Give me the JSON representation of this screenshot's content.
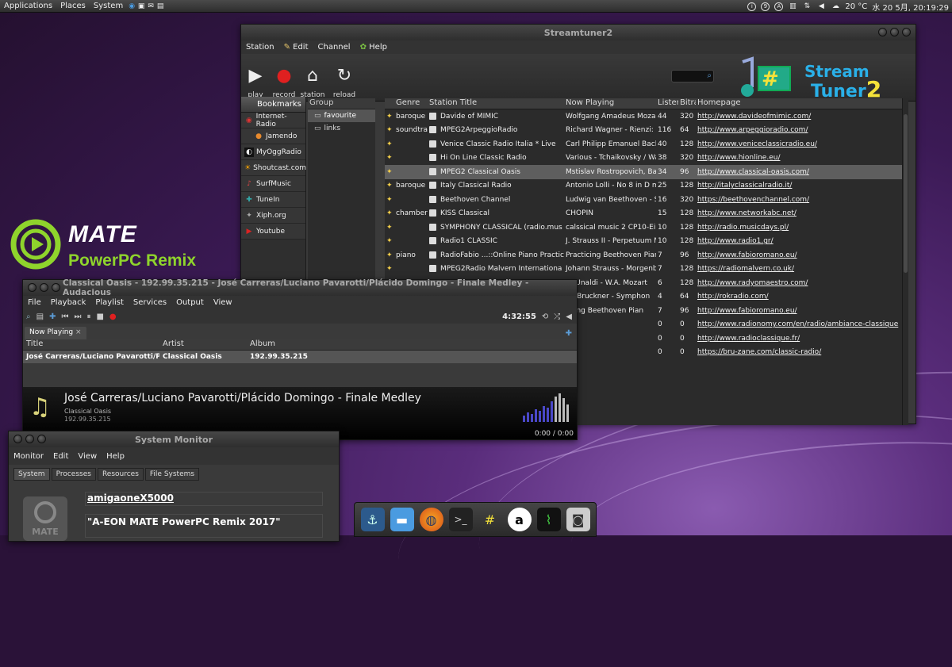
{
  "topbar": {
    "menus": [
      "Applications",
      "Places",
      "System"
    ],
    "circles": [
      "i",
      "9",
      "A"
    ],
    "weather": "20 °C",
    "datetime": "水 20 5月, 20:19:29"
  },
  "logo": {
    "title": "MATE",
    "subtitle": "PowerPC Remix"
  },
  "streamtuner": {
    "title": "Streamtuner2",
    "menu": [
      "Station",
      "Edit",
      "Channel",
      "Help"
    ],
    "tools": [
      {
        "icon": "play-icon",
        "label": "play"
      },
      {
        "icon": "record-icon",
        "label": "record"
      },
      {
        "icon": "home-icon",
        "label": "station"
      },
      {
        "icon": "reload-icon",
        "label": "reload"
      }
    ],
    "brand": {
      "line1": "Stream",
      "line2": "Tuner",
      "num": "2"
    },
    "bookmarks_label": "Bookmarks",
    "channels": [
      {
        "label": "Internet-Radio",
        "color": "#d33"
      },
      {
        "label": "Jamendo",
        "color": "#e88a2d"
      },
      {
        "label": "MyOggRadio",
        "color": "#333"
      },
      {
        "label": "Shoutcast.com",
        "color": "#f3a000"
      },
      {
        "label": "SurfMusic",
        "color": "#d44"
      },
      {
        "label": "TuneIn",
        "color": "#3aa"
      },
      {
        "label": "Xiph.org",
        "color": "#aaa"
      },
      {
        "label": "Youtube",
        "color": "#d22"
      }
    ],
    "group_header": "Group",
    "groups": [
      {
        "label": "favourite",
        "selected": true
      },
      {
        "label": "links",
        "selected": false
      }
    ],
    "headers": [
      "Genre",
      "Station Title",
      "Now Playing",
      "Listen",
      "Bitra",
      "Homepage"
    ],
    "rows": [
      {
        "genre": "baroque",
        "title": "Davide of MIMIC",
        "playing": "Wolfgang Amadeus Mozart",
        "listen": "44",
        "bitrate": "320",
        "home": "http://www.davideofmimic.com/"
      },
      {
        "genre": "soundtra",
        "title": "MPEG2ArpeggioRadio",
        "playing": "Richard Wagner - Rienzi: O",
        "listen": "116",
        "bitrate": "64",
        "home": "http://www.arpeggioradio.com/"
      },
      {
        "genre": "",
        "title": "Venice Classic Radio Italia * Live",
        "playing": "Carl Philipp Emanuel Bach",
        "listen": "40",
        "bitrate": "128",
        "home": "http://www.veniceclassicradio.eu/"
      },
      {
        "genre": "",
        "title": "Hi On Line Classic Radio",
        "playing": "Various - Tchaikovsky / Wa",
        "listen": "38",
        "bitrate": "320",
        "home": "http://www.hionline.eu/"
      },
      {
        "genre": "",
        "title": "MPEG2 Classical Oasis",
        "playing": "Mstislav Rostropovich, Bar",
        "listen": "34",
        "bitrate": "96",
        "home": "http://www.classical-oasis.com/",
        "selected": true
      },
      {
        "genre": "baroque",
        "title": "Italy Classical Radio",
        "playing": "Antonio Lolli - No 8 in D ma",
        "listen": "25",
        "bitrate": "128",
        "home": "http://italyclassicalradio.it/"
      },
      {
        "genre": "",
        "title": "Beethoven Channel",
        "playing": "Ludwig van Beethoven - St",
        "listen": "16",
        "bitrate": "320",
        "home": "https://beethovenchannel.com/"
      },
      {
        "genre": "chamber",
        "title": "KISS Classical",
        "playing": "CHOPIN",
        "listen": "15",
        "bitrate": "128",
        "home": "http://www.networkabc.net/"
      },
      {
        "genre": "",
        "title": "SYMPHONY CLASSICAL (radio.mus",
        "playing": "calssical music 2 CP10-Eine",
        "listen": "10",
        "bitrate": "128",
        "home": "http://radio.musicdays.pl/"
      },
      {
        "genre": "",
        "title": "Radio1 CLASSIC",
        "playing": "J. Strauss II - Perpetuum M",
        "listen": "10",
        "bitrate": "128",
        "home": "http://www.radio1.gr/"
      },
      {
        "genre": "piano",
        "title": "RadioFabio ...::Online Piano Practic",
        "playing": "Practicing Beethoven Pian",
        "listen": "7",
        "bitrate": "96",
        "home": "http://www.fabioromano.eu/"
      },
      {
        "genre": "",
        "title": "MPEG2Radio Malvern Internationa",
        "playing": "Johann Strauss - Morgenb",
        "listen": "7",
        "bitrate": "128",
        "home": "https://radiomalvern.co.uk/"
      },
      {
        "genre": "",
        "title": "",
        "playing": "ur Unaldi - W.A. Mozart",
        "listen": "6",
        "bitrate": "128",
        "home": "http://www.radyomaestro.com/"
      },
      {
        "genre": "",
        "title": "",
        "playing": "on Bruckner - Symphon",
        "listen": "4",
        "bitrate": "64",
        "home": "http://rokradio.com/"
      },
      {
        "genre": "",
        "title": "",
        "playing": "ticing Beethoven Pian",
        "listen": "7",
        "bitrate": "96",
        "home": "http://www.fabioromano.eu/"
      },
      {
        "genre": "",
        "title": "",
        "playing": "s",
        "listen": "0",
        "bitrate": "0",
        "home": "http://www.radionomy.com/en/radio/ambiance-classique"
      },
      {
        "genre": "",
        "title": "",
        "playing": "s",
        "listen": "0",
        "bitrate": "0",
        "home": "http://www.radioclassique.fr/"
      },
      {
        "genre": "",
        "title": "",
        "playing": "",
        "listen": "0",
        "bitrate": "0",
        "home": "https://bru-zane.com/classic-radio/"
      }
    ]
  },
  "audacious": {
    "title": "Classical Oasis - 192.99.35.215 - José Carreras/Luciano Pavarotti/Plácido Domingo - Finale Medley - Audacious",
    "menu": [
      "File",
      "Playback",
      "Playlist",
      "Services",
      "Output",
      "View"
    ],
    "time": "4:32:55",
    "tab": "Now Playing",
    "headers": [
      "Title",
      "Artist",
      "Album"
    ],
    "row": {
      "title": "José Carreras/Luciano Pavarotti/Pl...",
      "artist": "Classical Oasis",
      "album": "192.99.35.215"
    },
    "song": "José Carreras/Luciano Pavarotti/Plácido Domingo - Finale Medley",
    "station": "Classical Oasis",
    "ip": "192.99.35.215",
    "position": "0:00 / 0:00"
  },
  "sysmon": {
    "title": "System Monitor",
    "menu": [
      "Monitor",
      "Edit",
      "View",
      "Help"
    ],
    "tabs": [
      "System",
      "Processes",
      "Resources",
      "File Systems"
    ],
    "hostname": "amigaoneX5000",
    "distro": "\"A-EON MATE PowerPC Remix 2017\"",
    "badge": "MATE"
  },
  "dock": [
    "anchor-icon",
    "finder-icon",
    "firefox-icon",
    "terminal-icon",
    "streamtuner-icon",
    "audacious-icon",
    "sysmon-icon",
    "screenshot-icon"
  ]
}
